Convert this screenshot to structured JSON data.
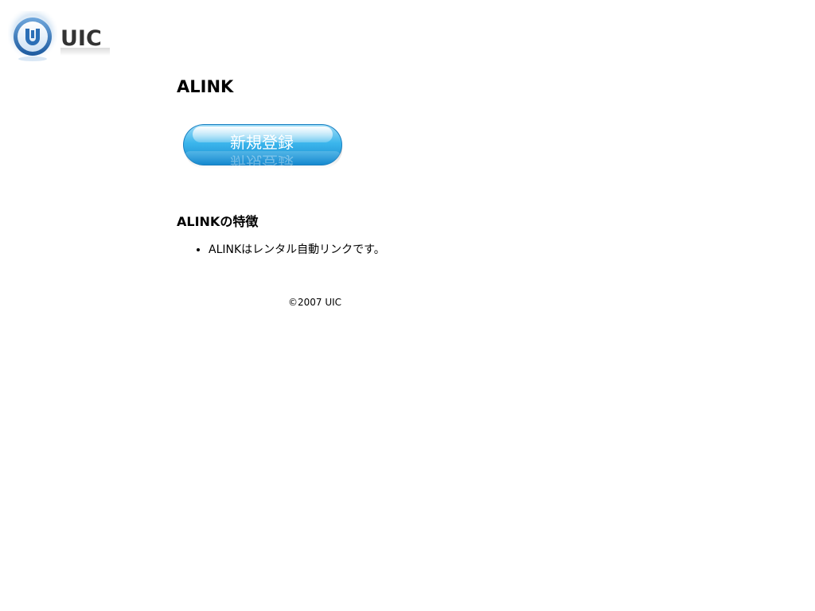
{
  "header": {
    "logo_text": "UIC",
    "logo_mark": "U"
  },
  "main": {
    "title": "ALINK",
    "register_button_label": "新規登録",
    "features_heading": "ALINKの特徴",
    "features": [
      "ALINKはレンタル自動リンクです。"
    ]
  },
  "footer": {
    "copyright": "©2007 UIC"
  },
  "colors": {
    "button_top": "#bfeafc",
    "button_mid": "#3cb6ec",
    "button_bottom": "#0a7fc2",
    "logo_blue": "#2b6fb6",
    "logo_text": "#333333"
  }
}
